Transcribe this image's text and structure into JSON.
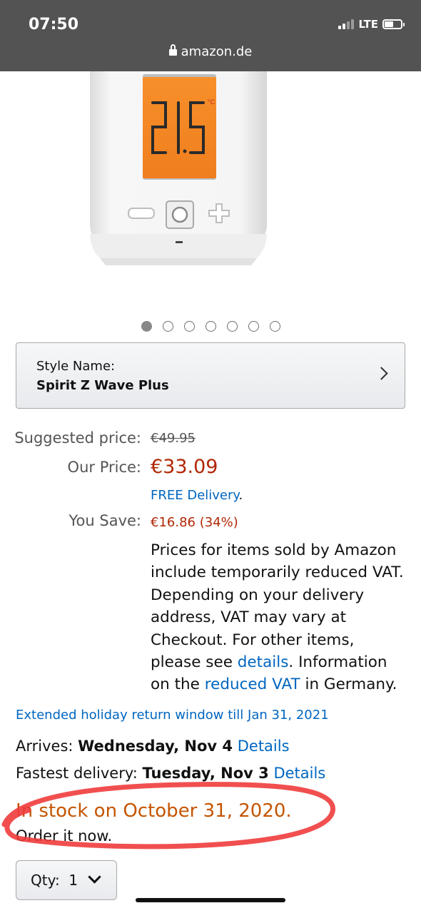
{
  "status_bar": {
    "time": "07:50",
    "network": "LTE",
    "url": "amazon.de"
  },
  "product": {
    "carousel": {
      "count": 7,
      "active_index": 0
    },
    "display_reading": "21.5"
  },
  "style": {
    "label": "Style Name:",
    "value": "Spirit Z Wave Plus"
  },
  "pricing": {
    "suggested_label": "Suggested price:",
    "suggested_value": "€49.95",
    "our_label": "Our Price:",
    "our_value": "€33.09",
    "delivery_link": "FREE Delivery",
    "delivery_period": ".",
    "save_label": "You Save:",
    "save_value": "€16.86 (34%)",
    "vat_note": {
      "part1": "Prices for items sold by Amazon include temporarily reduced VAT. Depending on your delivery address, VAT may vary at Checkout. For other items, please see ",
      "details_link": "details",
      "part2": ". Information on the ",
      "vat_link": "reduced VAT",
      "part3": " in Germany."
    }
  },
  "holiday_return": "Extended holiday return window till Jan 31, 2021",
  "delivery": {
    "arrives_label": "Arrives: ",
    "arrives_date": "Wednesday, Nov 4",
    "arrives_details": "Details",
    "fastest_label": "Fastest delivery: ",
    "fastest_date": "Tuesday, Nov 3",
    "fastest_details": "Details"
  },
  "stock": {
    "status": "In stock on October 31, 2020.",
    "note": "Order it now."
  },
  "quantity": {
    "label": "Qty:",
    "value": "1"
  },
  "colors": {
    "price": "#b12704",
    "link": "#0066c0",
    "stock": "#c45500",
    "annotation": "#f03c3c"
  }
}
